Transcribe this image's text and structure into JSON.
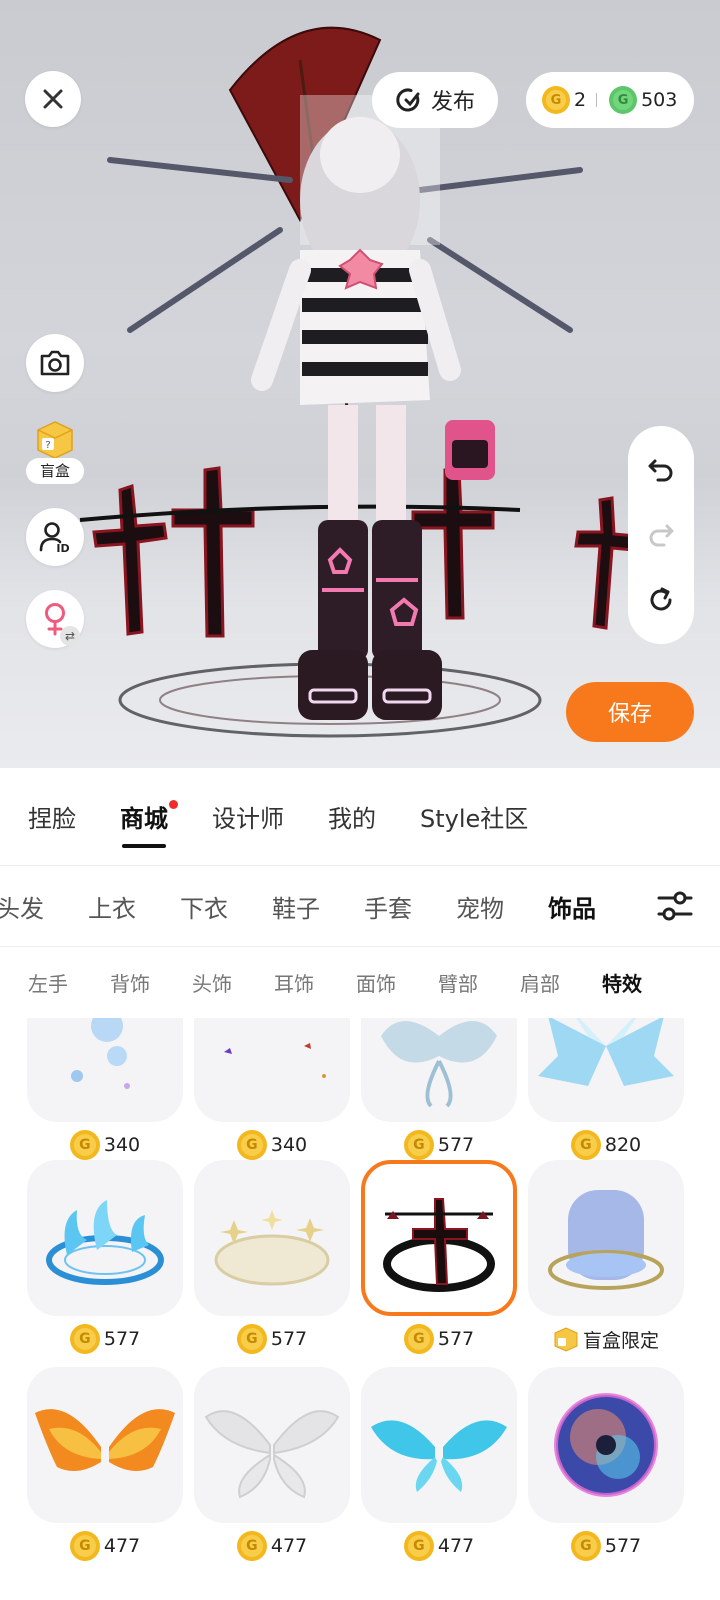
{
  "topbar": {
    "close_icon": "close-icon",
    "publish_label": "发布",
    "gold_coins": "2",
    "green_coins": "503"
  },
  "left_tools": {
    "blindbox_label": "盲盒",
    "id_text": "ID"
  },
  "actions": {
    "save_label": "保存"
  },
  "main_tabs": [
    {
      "label": "捏脸"
    },
    {
      "label": "商城",
      "active": true,
      "badge": "red-dot"
    },
    {
      "label": "设计师"
    },
    {
      "label": "我的"
    },
    {
      "label": "Style社区"
    }
  ],
  "category_tabs": [
    {
      "label": "头发"
    },
    {
      "label": "上衣"
    },
    {
      "label": "下衣"
    },
    {
      "label": "鞋子"
    },
    {
      "label": "手套"
    },
    {
      "label": "宠物"
    },
    {
      "label": "饰品",
      "active": true
    }
  ],
  "sub_tabs": [
    {
      "label": "左手"
    },
    {
      "label": "背饰"
    },
    {
      "label": "头饰"
    },
    {
      "label": "耳饰"
    },
    {
      "label": "面饰"
    },
    {
      "label": "臂部"
    },
    {
      "label": "肩部"
    },
    {
      "label": "特效",
      "active": true
    }
  ],
  "items": [
    {
      "price": "340",
      "thumb": "blue-sparkle-effect"
    },
    {
      "price": "340",
      "thumb": "butterfly-petal-effect"
    },
    {
      "price": "577",
      "thumb": "frost-wings-effect"
    },
    {
      "price": "820",
      "thumb": "ice-crystal-wings-effect"
    },
    {
      "price": "577",
      "thumb": "blue-flame-circle-effect"
    },
    {
      "price": "577",
      "thumb": "golden-star-circle-effect"
    },
    {
      "price": "577",
      "thumb": "dark-cross-circle-effect",
      "selected": true
    },
    {
      "price": "盲盒限定",
      "thumb": "blue-portal-effect",
      "price_type": "blindbox"
    },
    {
      "price": "477",
      "thumb": "fire-wings-effect"
    },
    {
      "price": "477",
      "thumb": "white-fairy-wings-effect"
    },
    {
      "price": "477",
      "thumb": "cyan-wings-effect"
    },
    {
      "price": "577",
      "thumb": "cosmic-orb-effect"
    }
  ],
  "colors": {
    "accent_orange": "#f7791b",
    "coin_gold": "#f3b81d",
    "coin_green": "#5cc66a",
    "badge_red": "#f02b2b"
  }
}
